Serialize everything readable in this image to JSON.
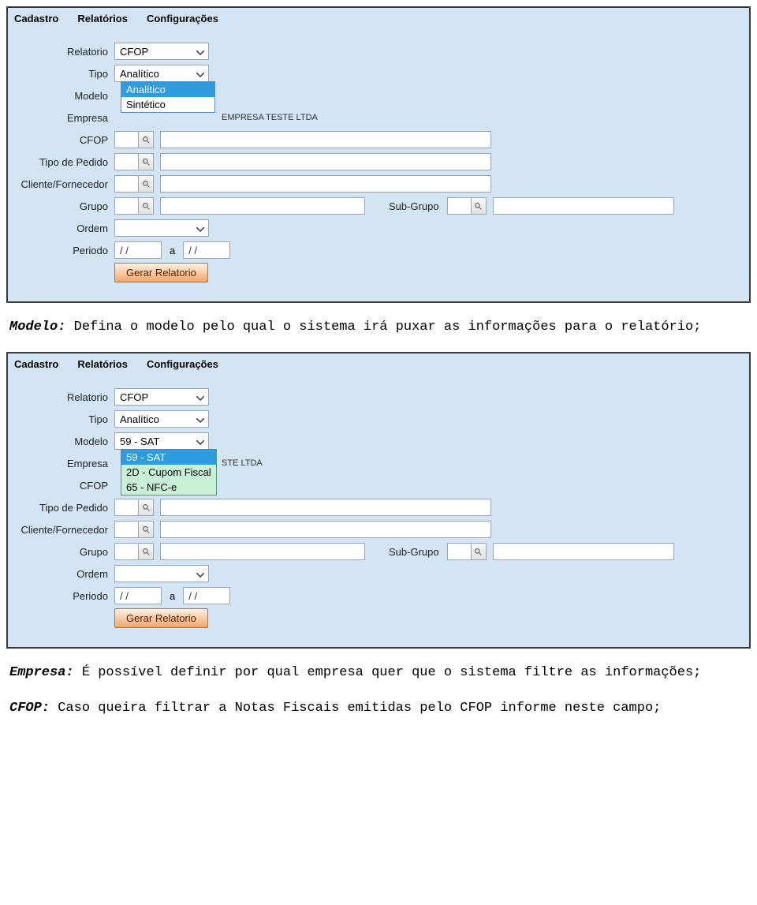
{
  "menu": {
    "cadastro": "Cadastro",
    "relatorios": "Relatórios",
    "config": "Configurações"
  },
  "labels": {
    "relatorio": "Relatorio",
    "tipo": "Tipo",
    "modelo": "Modelo",
    "empresa": "Empresa",
    "cfop": "CFOP",
    "tipo_pedido": "Tipo de Pedido",
    "cliente_forn": "Cliente/Fornecedor",
    "grupo": "Grupo",
    "subgrupo": "Sub-Grupo",
    "ordem": "Ordem",
    "periodo": "Periodo",
    "a": "a"
  },
  "values": {
    "relatorio": "CFOP",
    "tipo_selected": "Analítico",
    "tipo_options": [
      "Analítico",
      "Sintético"
    ],
    "modelo_blank": "",
    "modelo_selected": "59 - SAT",
    "modelo_options": [
      "59 - SAT",
      "2D - Cupom Fiscal",
      "65 - NFC-e"
    ],
    "empresa_code": "",
    "empresa_name": "EMPRESA TESTE LTDA",
    "empresa_name_partial": "STE LTDA",
    "date_placeholder": "  /  /",
    "ordem": ""
  },
  "buttons": {
    "gerar": "Gerar Relatorio"
  },
  "text": {
    "p1_bold": "Modelo:",
    "p1_rest": " Defina o modelo pelo qual o sistema irá puxar as informações para o relatório;",
    "p2_bold": "Empresa:",
    "p2_rest": " É possível definir por qual empresa quer que o sistema filtre as informações;",
    "p3_bold": "CFOP:",
    "p3_rest": " Caso queira filtrar a Notas Fiscais emitidas pelo CFOP informe neste campo;"
  }
}
